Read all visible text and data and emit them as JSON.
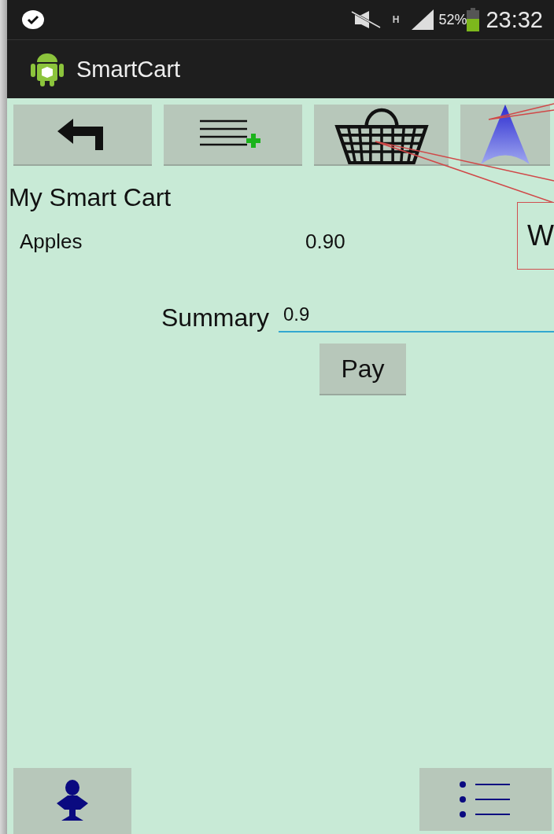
{
  "status_bar": {
    "network": "H",
    "battery": "52%",
    "time": "23:32"
  },
  "action_bar": {
    "title": "SmartCart"
  },
  "heading": "My Smart Cart",
  "items": [
    {
      "name": "Apples",
      "price": "0.90"
    }
  ],
  "summary": {
    "label": "Summary",
    "value": "0.9"
  },
  "pay_button": "Pay",
  "callout": {
    "text": "W"
  }
}
